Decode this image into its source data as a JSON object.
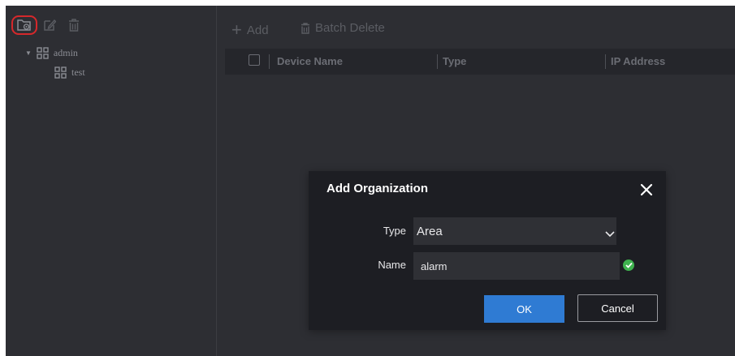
{
  "tree_toolbar": {
    "icons": [
      "add-folder-icon",
      "edit-icon",
      "trash-icon"
    ]
  },
  "tree": {
    "root": {
      "label": "admin",
      "icon": "grid-org-icon"
    },
    "children": [
      {
        "label": "test",
        "icon": "grid-org-icon"
      }
    ]
  },
  "toolbar": {
    "add_label": "Add",
    "batch_delete_label": "Batch Delete"
  },
  "table": {
    "columns": [
      "Device Name",
      "Type",
      "IP Address"
    ]
  },
  "dialog": {
    "title": "Add Organization",
    "type_label": "Type",
    "type_value": "Area",
    "name_label": "Name",
    "name_value": "alarm",
    "ok_label": "OK",
    "cancel_label": "Cancel"
  },
  "colors": {
    "panel_bg": "#2d2e33",
    "dialog_bg": "#1d1e23",
    "primary": "#2f7bd3",
    "highlight": "#d6282b",
    "valid": "#3fb34f"
  }
}
